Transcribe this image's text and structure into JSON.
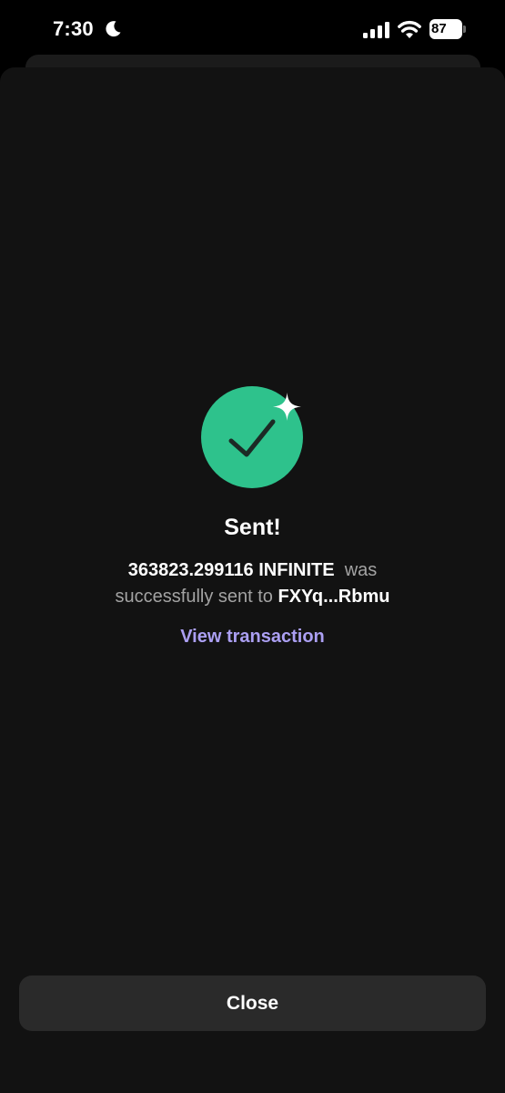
{
  "status_bar": {
    "time": "7:30",
    "battery": "87",
    "icons": [
      "moon-icon",
      "cellular-signal-icon",
      "wifi-icon",
      "battery-icon"
    ]
  },
  "result": {
    "icon": "checkmark-circle-icon",
    "sparkle_icon": "sparkle-icon",
    "title": "Sent!",
    "amount": "363823.299116 INFINITE",
    "mid_text": "was",
    "mid_text_2": "successfully sent to",
    "recipient": "FXYq...Rbmu",
    "link_label": "View transaction"
  },
  "actions": {
    "close_label": "Close"
  },
  "colors": {
    "background": "#121212",
    "success_green": "#2ec28c",
    "accent_purple": "#ab9ff2",
    "button_bg": "#2a2a2a",
    "muted_text": "#a3a3a3"
  }
}
